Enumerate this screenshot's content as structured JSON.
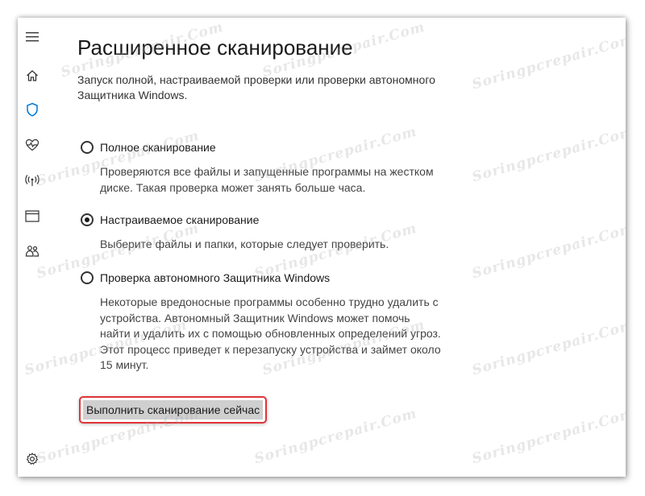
{
  "page": {
    "title": "Расширенное сканирование",
    "description": "Запуск полной, настраиваемой проверки или проверки автономного Защитника Windows."
  },
  "options": [
    {
      "label": "Полное сканирование",
      "description": "Проверяются все файлы и запущенные программы на жестком диске. Такая проверка может занять больше часа.",
      "checked": false
    },
    {
      "label": "Настраиваемое сканирование",
      "description": "Выберите файлы и папки, которые следует проверить.",
      "checked": true
    },
    {
      "label": "Проверка автономного Защитника Windows",
      "description": "Некоторые вредоносные программы особенно трудно удалить с устройства. Автономный Защитник Windows может помочь найти и удалить их с помощью обновленных определений угроз. Этот процесс приведет к перезапуску устройства и займет около 15 минут.",
      "checked": false
    }
  ],
  "scan_button": {
    "label": "Выполнить сканирование сейчас"
  },
  "sidebar": {
    "icons": [
      "hamburger-menu-icon",
      "home-icon",
      "shield-icon",
      "heart-pulse-icon",
      "wifi-antenna-icon",
      "browser-window-icon",
      "family-icon",
      "settings-gear-icon"
    ]
  },
  "watermark": {
    "text": "Soringpcrepair.Com"
  },
  "colors": {
    "accent": "#0078d7",
    "highlight_border": "#e0353a",
    "button_bg": "#cfcfcf"
  }
}
